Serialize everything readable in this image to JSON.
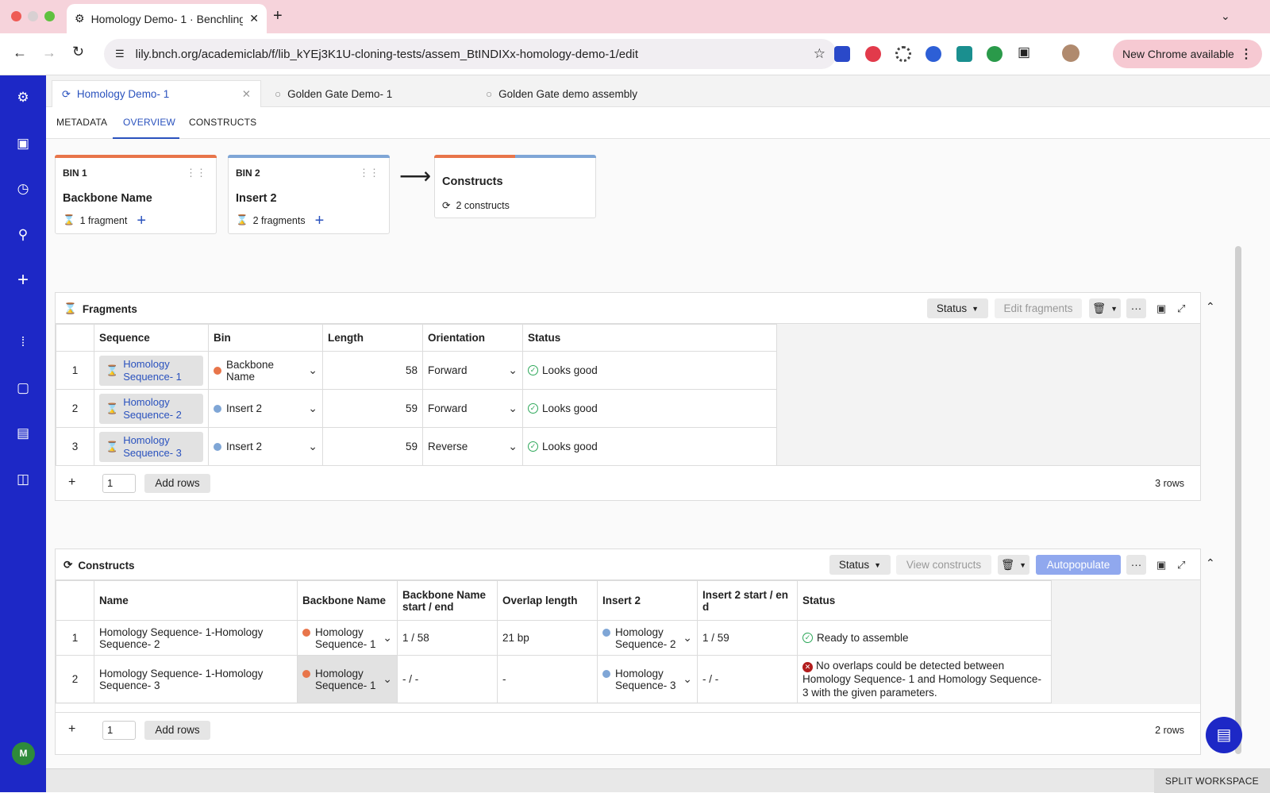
{
  "browser": {
    "tab_title": "Homology Demo- 1 · Benchling",
    "new_tab": "+",
    "url": "lily.bnch.org/academiclab/f/lib_kYEj3K1U-cloning-tests/assem_BtINDIXx-homology-demo-1/edit",
    "new_chrome": "New Chrome available",
    "ext_menu": "⋮",
    "ext_colors": [
      "#2a49c9",
      "#e23a4b",
      "#444",
      "#2d5fd6",
      "#1a8f8f",
      "#2a9a4a",
      "#555"
    ]
  },
  "rail": {
    "avatar": "M"
  },
  "doc_tabs": [
    {
      "label": "Homology Demo- 1"
    },
    {
      "label": "Golden Gate Demo- 1"
    },
    {
      "label": "Golden Gate demo assembly"
    }
  ],
  "sub_tabs": [
    "METADATA",
    "OVERVIEW",
    "CONSTRUCTS"
  ],
  "bins": [
    {
      "label": "BIN 1",
      "name": "Backbone Name",
      "fragments": "1 fragment",
      "color": "#e8754a"
    },
    {
      "label": "BIN 2",
      "name": "Insert 2",
      "fragments": "2 fragments",
      "color": "#7fa6d6"
    }
  ],
  "constructs_card": {
    "title": "Constructs",
    "count": "2 constructs"
  },
  "fragments": {
    "title": "Fragments",
    "buttons": {
      "status": "Status",
      "edit": "Edit fragments",
      "more": "···"
    },
    "columns": [
      "Sequence",
      "Bin",
      "Length",
      "Orientation",
      "Status"
    ],
    "rows": [
      {
        "idx": "1",
        "seq": "Homology Sequence- 1",
        "bin": "Backbone Name",
        "bin_color": "#e8754a",
        "length": "58",
        "orientation": "Forward",
        "status": "Looks good"
      },
      {
        "idx": "2",
        "seq": "Homology Sequence- 2",
        "bin": "Insert 2",
        "bin_color": "#7fa6d6",
        "length": "59",
        "orientation": "Forward",
        "status": "Looks good"
      },
      {
        "idx": "3",
        "seq": "Homology Sequence- 3",
        "bin": "Insert 2",
        "bin_color": "#7fa6d6",
        "length": "59",
        "orientation": "Reverse",
        "status": "Looks good"
      }
    ],
    "footer": {
      "plus": "+",
      "count_value": "1",
      "add_rows": "Add rows",
      "rows": "3 rows"
    }
  },
  "constructs": {
    "title": "Constructs",
    "buttons": {
      "status": "Status",
      "view": "View constructs",
      "autopopulate": "Autopopulate",
      "more": "···"
    },
    "columns": [
      "Name",
      "Backbone Name",
      "Backbone Name start / end",
      "Overlap length",
      "Insert 2",
      "Insert 2 start / en d",
      "Status"
    ],
    "rows": [
      {
        "idx": "1",
        "name": "Homology Sequence- 1-Homology Sequence- 2",
        "backbone": "Homology Sequence- 1",
        "bb_range": "1 / 58",
        "overlap": "21 bp",
        "insert": "Homology Sequence- 2",
        "ins_range": "1 / 59",
        "status": "Ready to assemble",
        "status_type": "ok"
      },
      {
        "idx": "2",
        "name": "Homology Sequence- 1-Homology Sequence- 3",
        "backbone": "Homology Sequence- 1",
        "bb_range": "- / -",
        "overlap": "-",
        "insert": "Homology Sequence- 3",
        "ins_range": "- / -",
        "status": "No overlaps could be detected between Homology Sequence- 1 and Homology Sequence- 3 with the given parameters.",
        "status_type": "error"
      }
    ],
    "footer": {
      "plus": "+",
      "count_value": "1",
      "add_rows": "Add rows",
      "rows": "2 rows"
    }
  },
  "statusbar": {
    "split": "SPLIT WORKSPACE"
  },
  "colors": {
    "accent": "#2a52be",
    "rail": "#1d28c6",
    "backbone": "#e8754a",
    "insert": "#7fa6d6"
  }
}
